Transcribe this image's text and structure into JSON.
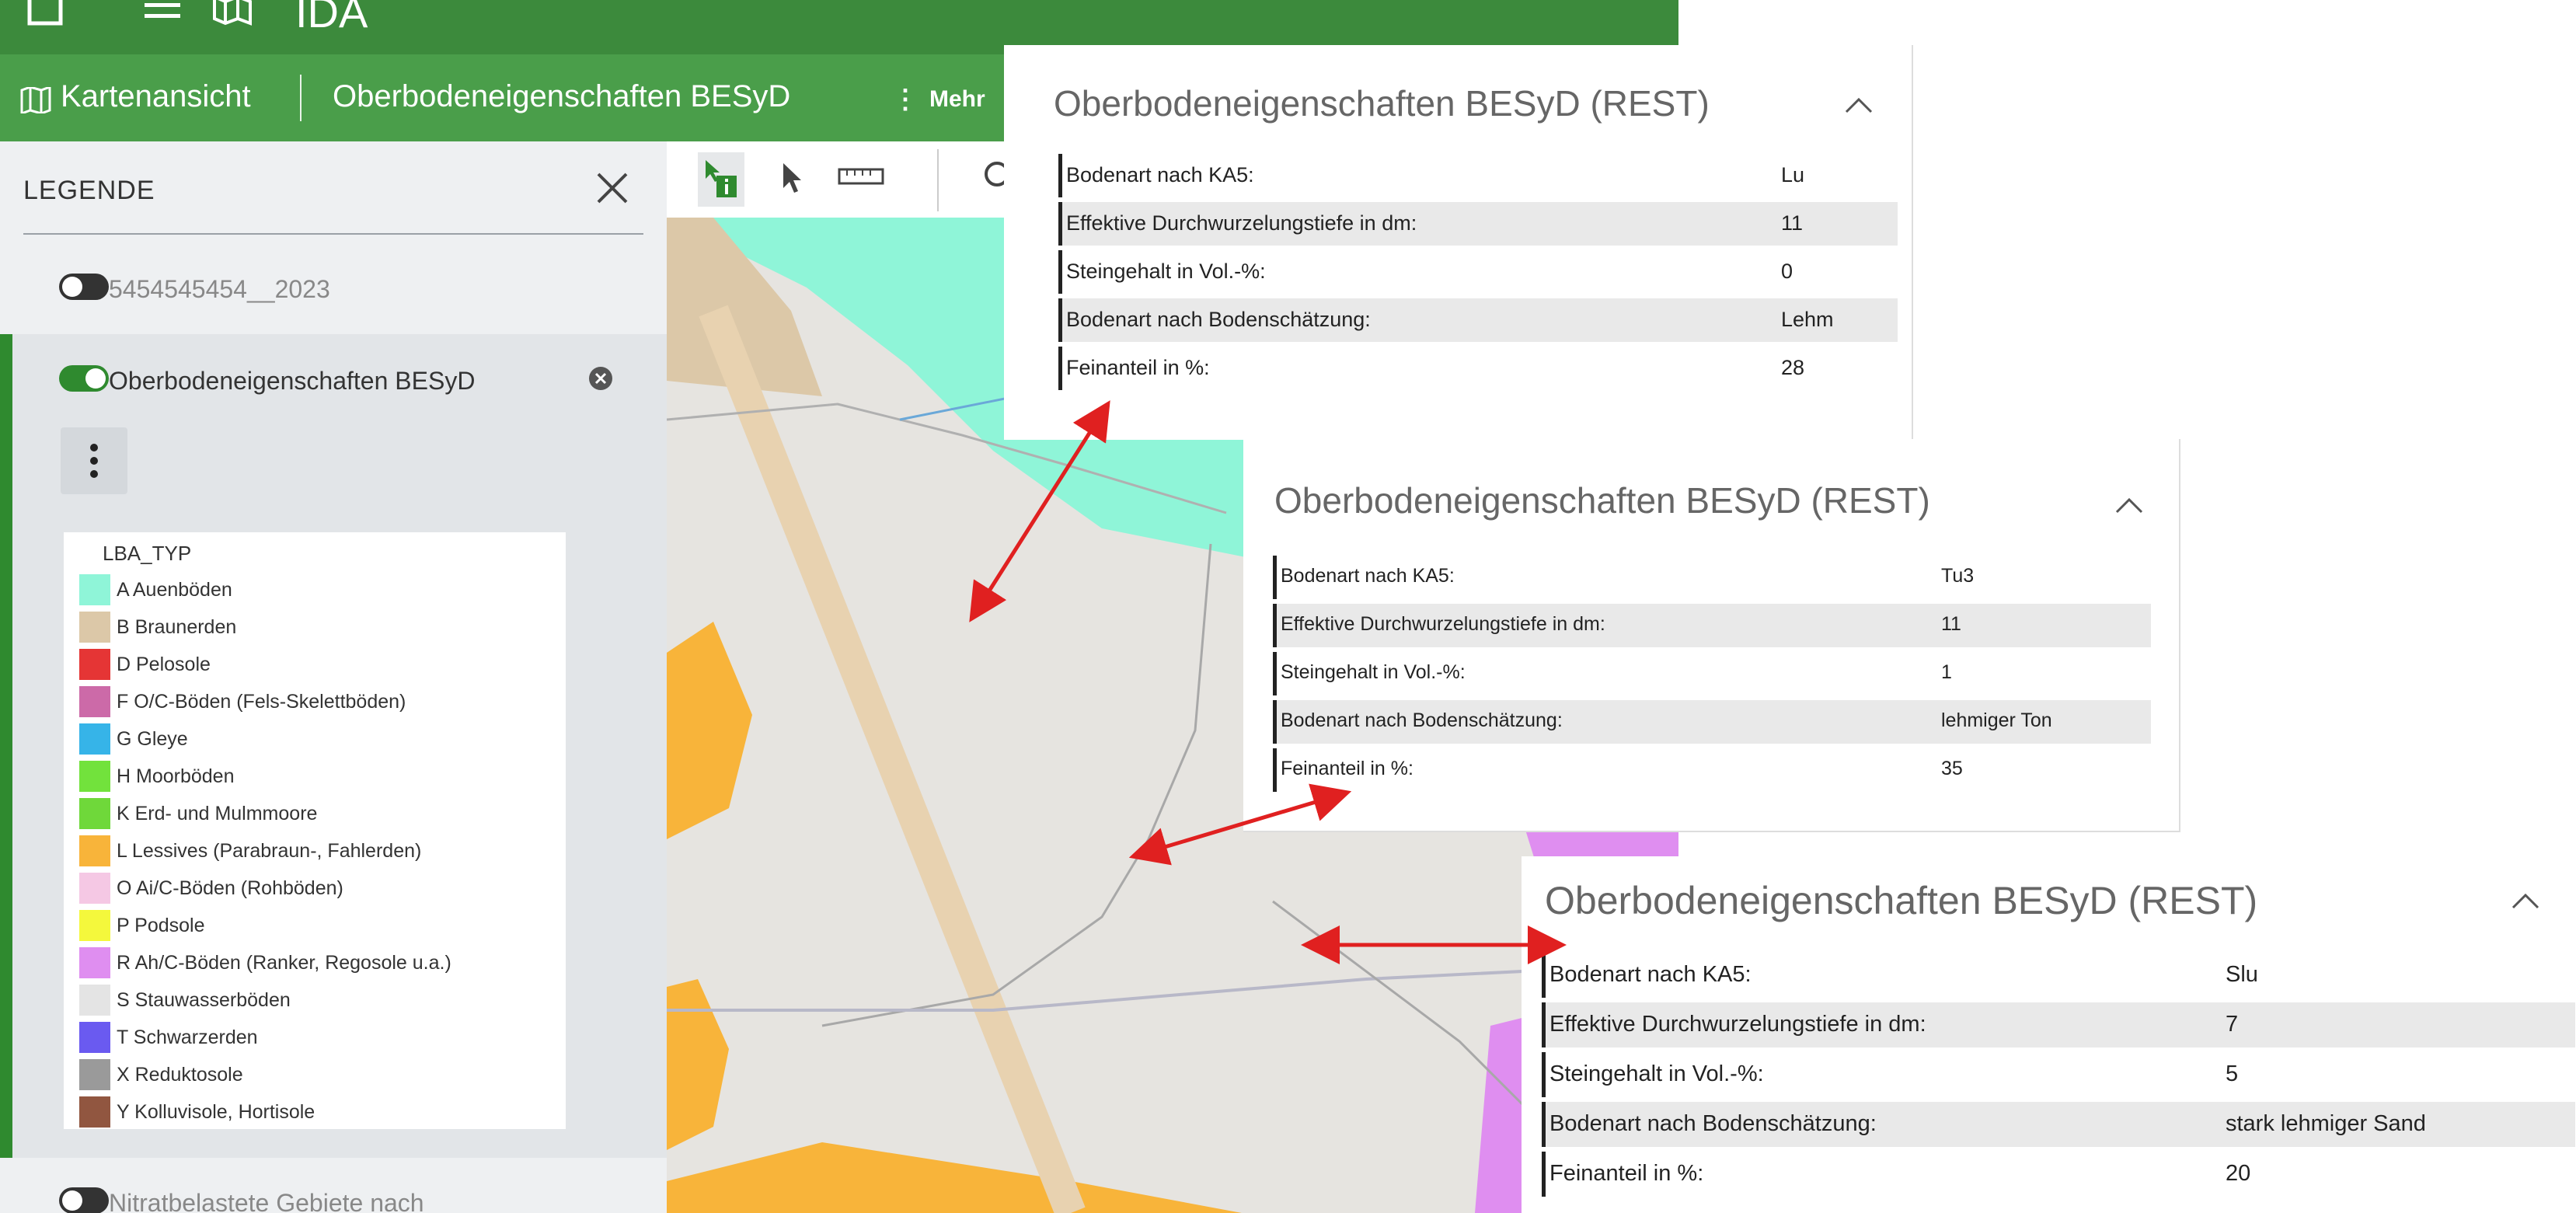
{
  "app": {
    "title": "IDA",
    "view_label": "Kartenansicht",
    "layer_title": "Oberbodeneigenschaften BESyD",
    "more_label": "Mehr"
  },
  "legend": {
    "title": "LEGENDE",
    "layers": [
      {
        "name": "5454545454__2023",
        "enabled": false
      },
      {
        "name": "Oberbodeneigenschaften BESyD",
        "enabled": true
      },
      {
        "name": "Nitratbelastete Gebiete nach",
        "enabled": false
      }
    ],
    "type_header": "LBA_TYP",
    "items": [
      {
        "label": "A  Auenböden",
        "color": "#8ff5d8"
      },
      {
        "label": "B  Braunerden",
        "color": "#dcc8a8"
      },
      {
        "label": "D  Pelosole",
        "color": "#e53535"
      },
      {
        "label": "F   O/C-Böden (Fels-Skelettböden)",
        "color": "#cc6aa8"
      },
      {
        "label": "G  Gleye",
        "color": "#36b4e8"
      },
      {
        "label": "H  Moorböden",
        "color": "#72e23c"
      },
      {
        "label": "K  Erd- und Mulmmoore",
        "color": "#6fd83a"
      },
      {
        "label": "L  Lessives (Parabraun-, Fahlerden)",
        "color": "#f8b43a"
      },
      {
        "label": "O  Ai/C-Böden (Rohböden)",
        "color": "#f5c8e4"
      },
      {
        "label": "P  Podsole",
        "color": "#f4f83c"
      },
      {
        "label": "R  Ah/C-Böden (Ranker, Regosole u.a.)",
        "color": "#df8ef0"
      },
      {
        "label": "S  Stauwasserböden",
        "color": "#e4e4e4"
      },
      {
        "label": "T  Schwarzerden",
        "color": "#6a5af0"
      },
      {
        "label": "X  Reduktosole",
        "color": "#9a9a9a"
      },
      {
        "label": "Y  Kolluvisole, Hortisole",
        "color": "#915640"
      }
    ]
  },
  "popups": [
    {
      "title": "Oberbodeneigenschaften BESyD (REST)",
      "rows": [
        {
          "key": "Bodenart nach KA5:",
          "value": "Lu"
        },
        {
          "key": "Effektive Durchwurzelungstiefe in dm:",
          "value": "11"
        },
        {
          "key": "Steingehalt in Vol.-%:",
          "value": "0"
        },
        {
          "key": "Bodenart nach Bodenschätzung:",
          "value": "Lehm"
        },
        {
          "key": "Feinanteil in %:",
          "value": "28"
        }
      ]
    },
    {
      "title": "Oberbodeneigenschaften BESyD (REST)",
      "rows": [
        {
          "key": "Bodenart nach KA5:",
          "value": "Tu3"
        },
        {
          "key": "Effektive Durchwurzelungstiefe in dm:",
          "value": "11"
        },
        {
          "key": "Steingehalt in Vol.-%:",
          "value": "1"
        },
        {
          "key": "Bodenart nach Bodenschätzung:",
          "value": "lehmiger Ton"
        },
        {
          "key": "Feinanteil in %:",
          "value": "35"
        }
      ]
    },
    {
      "title": "Oberbodeneigenschaften BESyD (REST)",
      "rows": [
        {
          "key": "Bodenart nach KA5:",
          "value": "Slu"
        },
        {
          "key": "Effektive Durchwurzelungstiefe in dm:",
          "value": "7"
        },
        {
          "key": "Steingehalt in Vol.-%:",
          "value": "5"
        },
        {
          "key": "Bodenart nach Bodenschätzung:",
          "value": "stark lehmiger Sand"
        },
        {
          "key": "Feinanteil in %:",
          "value": "20"
        }
      ]
    }
  ],
  "colors": {
    "header_green": "#3c8a3c",
    "subheader_green": "#4a9e4a",
    "accent_green": "#2f8a2f",
    "arrow_red": "#e02020"
  },
  "icons": [
    "window-icon",
    "menu-icon",
    "map-icon",
    "kebab-icon",
    "close-icon",
    "remove-circle-icon",
    "info-select-icon",
    "pointer-icon",
    "ruler-icon",
    "chevron-up-icon"
  ]
}
